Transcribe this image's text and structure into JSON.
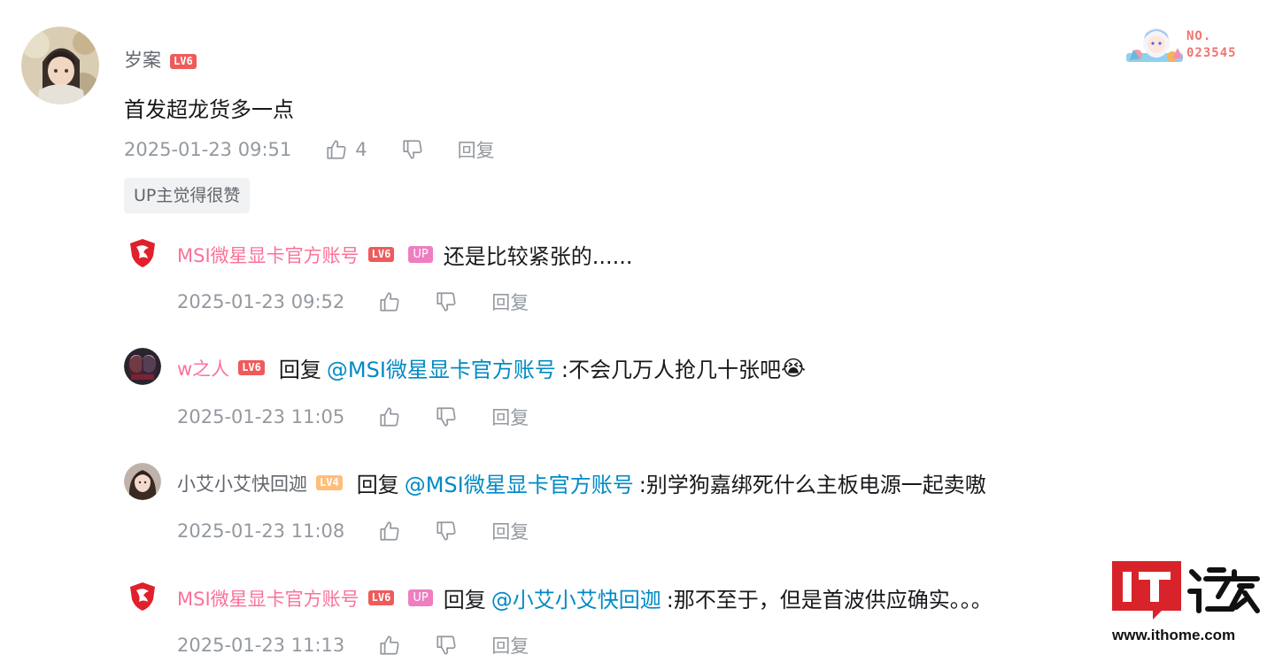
{
  "comment": {
    "username": "岁案",
    "level": "LV6",
    "content": "首发超龙货多一点",
    "time": "2025-01-23 09:51",
    "like_count": "4",
    "reply_label": "回复",
    "up_liked_tag": "UP主觉得很赞"
  },
  "fan_badge": {
    "no_label": "NO.",
    "number": "023545"
  },
  "replies": [
    {
      "username": "MSI微星显卡官方账号",
      "level": "LV6",
      "up_tag": "UP",
      "prefix": "",
      "mention": "",
      "text": "还是比较紧张的......",
      "time": "2025-01-23 09:52",
      "reply_label": "回复"
    },
    {
      "username": "w之人",
      "level": "LV6",
      "prefix": "回复",
      "mention": "@MSI微星显卡官方账号",
      "text": ":不会几万人抢几十张吧",
      "emoji": "😭",
      "time": "2025-01-23 11:05",
      "reply_label": "回复"
    },
    {
      "username": "小艾小艾快回迦",
      "level": "LV4",
      "prefix": "回复",
      "mention": "@MSI微星显卡官方账号",
      "text": ":别学狗嘉绑死什么主板电源一起卖嗷",
      "time": "2025-01-23 11:08",
      "reply_label": "回复"
    },
    {
      "username": "MSI微星显卡官方账号",
      "level": "LV6",
      "up_tag": "UP",
      "prefix": "回复",
      "mention": "@小艾小艾快回迦",
      "text": ":那不至于，但是首波供应确实。。。",
      "time": "2025-01-23 11:13",
      "reply_label": "回复"
    }
  ],
  "watermark": {
    "logo_text": "IT之家",
    "url": "www.ithome.com"
  },
  "colors": {
    "username_vip": "#fb7299",
    "mention": "#008ac5",
    "meta": "#9499a0",
    "lv6": "#ee5b5b",
    "lv4": "#ffbe7a",
    "up_tag": "#ee7ec0"
  }
}
